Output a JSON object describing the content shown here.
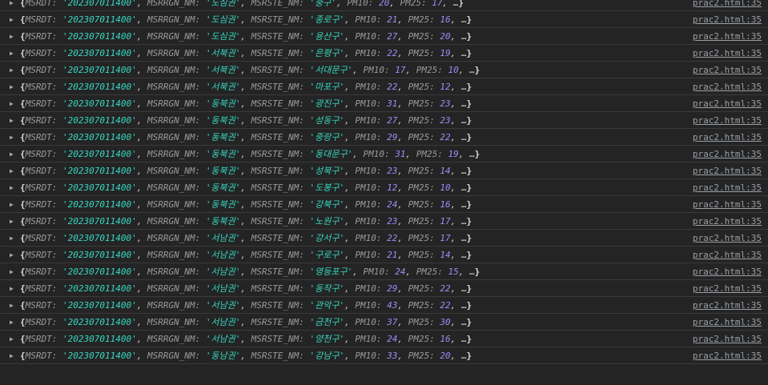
{
  "source": "prac2.html:35",
  "keys": {
    "date": "MSRDT",
    "region": "MSRRGN_NM",
    "station": "MSRSTE_NM",
    "pm10": "PM10",
    "pm25": "PM25"
  },
  "rows": [
    {
      "date": "202307011400",
      "region": "도심권",
      "station": "중구",
      "pm10": 20,
      "pm25": 17
    },
    {
      "date": "202307011400",
      "region": "도심권",
      "station": "종로구",
      "pm10": 21,
      "pm25": 16
    },
    {
      "date": "202307011400",
      "region": "도심권",
      "station": "용산구",
      "pm10": 27,
      "pm25": 20
    },
    {
      "date": "202307011400",
      "region": "서북권",
      "station": "은평구",
      "pm10": 22,
      "pm25": 19
    },
    {
      "date": "202307011400",
      "region": "서북권",
      "station": "서대문구",
      "pm10": 17,
      "pm25": 10
    },
    {
      "date": "202307011400",
      "region": "서북권",
      "station": "마포구",
      "pm10": 22,
      "pm25": 12
    },
    {
      "date": "202307011400",
      "region": "동북권",
      "station": "광진구",
      "pm10": 31,
      "pm25": 23
    },
    {
      "date": "202307011400",
      "region": "동북권",
      "station": "성동구",
      "pm10": 27,
      "pm25": 23
    },
    {
      "date": "202307011400",
      "region": "동북권",
      "station": "중랑구",
      "pm10": 29,
      "pm25": 22
    },
    {
      "date": "202307011400",
      "region": "동북권",
      "station": "동대문구",
      "pm10": 31,
      "pm25": 19
    },
    {
      "date": "202307011400",
      "region": "동북권",
      "station": "성북구",
      "pm10": 23,
      "pm25": 14
    },
    {
      "date": "202307011400",
      "region": "동북권",
      "station": "도봉구",
      "pm10": 12,
      "pm25": 10
    },
    {
      "date": "202307011400",
      "region": "동북권",
      "station": "강북구",
      "pm10": 24,
      "pm25": 16
    },
    {
      "date": "202307011400",
      "region": "동북권",
      "station": "노원구",
      "pm10": 23,
      "pm25": 17
    },
    {
      "date": "202307011400",
      "region": "서남권",
      "station": "강서구",
      "pm10": 22,
      "pm25": 17
    },
    {
      "date": "202307011400",
      "region": "서남권",
      "station": "구로구",
      "pm10": 21,
      "pm25": 14
    },
    {
      "date": "202307011400",
      "region": "서남권",
      "station": "영등포구",
      "pm10": 24,
      "pm25": 15
    },
    {
      "date": "202307011400",
      "region": "서남권",
      "station": "동작구",
      "pm10": 29,
      "pm25": 22
    },
    {
      "date": "202307011400",
      "region": "서남권",
      "station": "관악구",
      "pm10": 43,
      "pm25": 22
    },
    {
      "date": "202307011400",
      "region": "서남권",
      "station": "금천구",
      "pm10": 37,
      "pm25": 30
    },
    {
      "date": "202307011400",
      "region": "서남권",
      "station": "양천구",
      "pm10": 24,
      "pm25": 16
    },
    {
      "date": "202307011400",
      "region": "동남권",
      "station": "강남구",
      "pm10": 33,
      "pm25": 20
    }
  ]
}
